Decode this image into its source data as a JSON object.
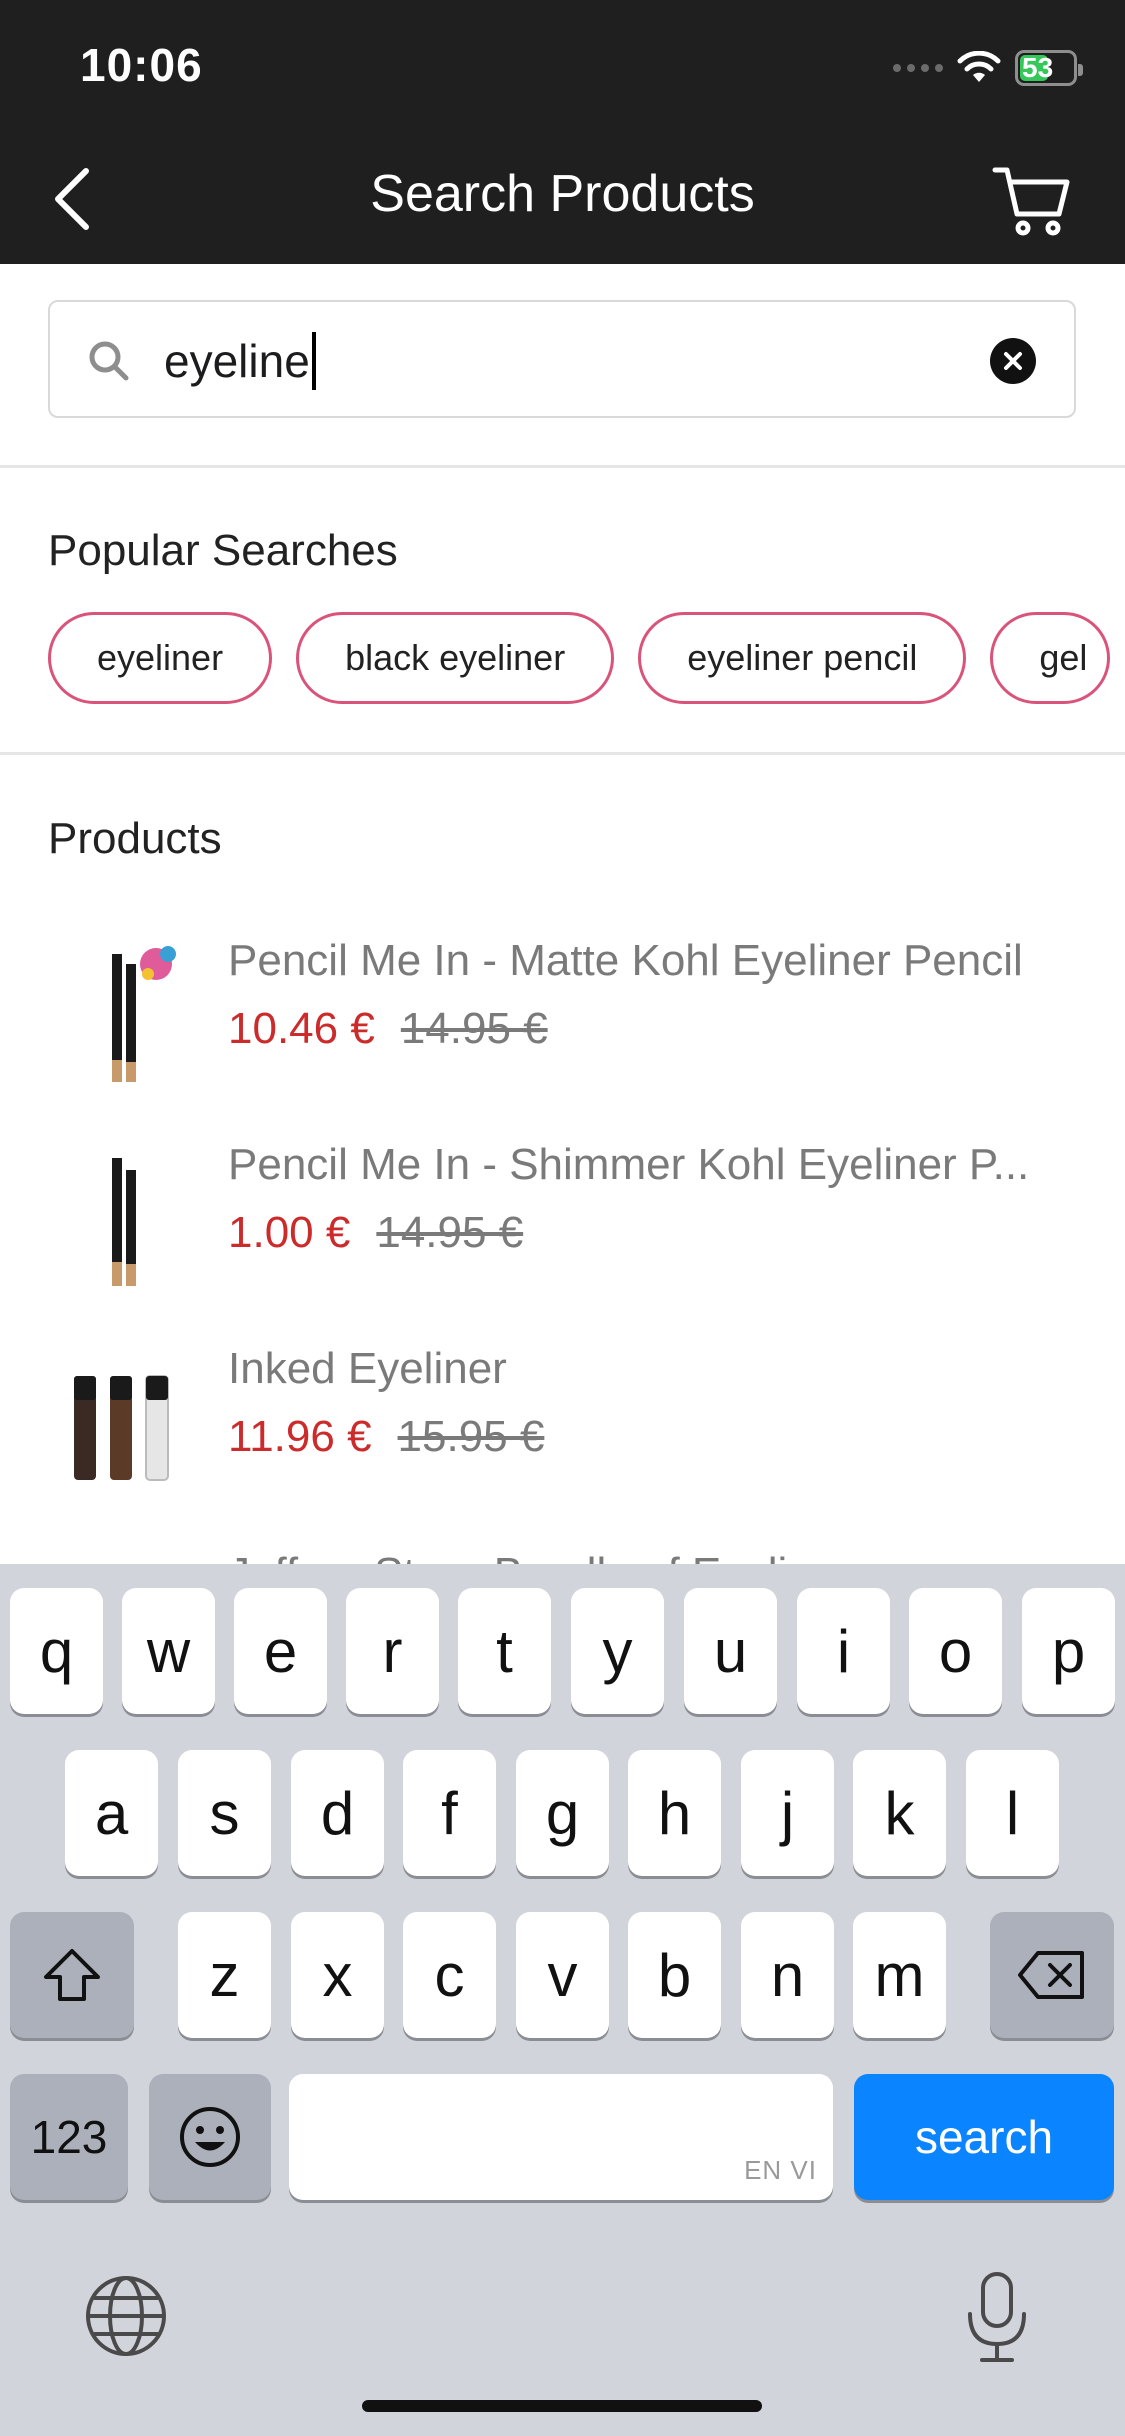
{
  "status_bar": {
    "time": "10:06",
    "battery": "53"
  },
  "nav": {
    "title": "Search Products",
    "icons": [
      "back-chevron-icon",
      "cart-icon"
    ]
  },
  "search": {
    "value": "eyeline",
    "icon": "search-icon",
    "clear_icon": "clear-icon"
  },
  "popular": {
    "title": "Popular Searches",
    "chips": [
      "eyeliner",
      "black eyeliner",
      "eyeliner pencil",
      "gel"
    ]
  },
  "products": {
    "title": "Products",
    "items": [
      {
        "name": "Pencil Me In - Matte Kohl Eyeliner Pencil",
        "price": "10.46 €",
        "old_price": "14.95 €"
      },
      {
        "name": "Pencil Me In - Shimmer Kohl Eyeliner P...",
        "price": "1.00 €",
        "old_price": "14.95 €"
      },
      {
        "name": "Inked Eyeliner",
        "price": "11.96 €",
        "old_price": "15.95 €"
      }
    ],
    "partial_name": "Jeffree Star - Bundle of Eyeliner"
  },
  "keyboard": {
    "row1": [
      "q",
      "w",
      "e",
      "r",
      "t",
      "y",
      "u",
      "i",
      "o",
      "p"
    ],
    "row2": [
      "a",
      "s",
      "d",
      "f",
      "g",
      "h",
      "j",
      "k",
      "l"
    ],
    "row3": [
      "z",
      "x",
      "c",
      "v",
      "b",
      "n",
      "m"
    ],
    "numbers_label": "123",
    "search_label": "search",
    "space_hint": "EN VI",
    "icons": [
      "shift-icon",
      "backspace-icon",
      "emoji-icon",
      "globe-icon",
      "microphone-icon"
    ]
  },
  "colors": {
    "header_bg": "#1f1f1f",
    "chip_border": "#d9537a",
    "sale_price": "#cc2b2b",
    "search_key": "#0a84ff",
    "battery": "#34c759"
  }
}
